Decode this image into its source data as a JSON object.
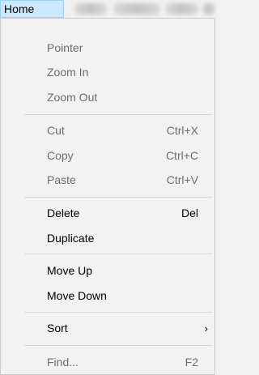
{
  "menubar": {
    "active_tab": "Home",
    "other_tabs_blurred": [
      "tab-2",
      "tab-3",
      "tab-4",
      "tab-5"
    ]
  },
  "menu": {
    "pointer": "Pointer",
    "zoom_in": "Zoom In",
    "zoom_out": "Zoom Out",
    "cut": {
      "label": "Cut",
      "shortcut": "Ctrl+X"
    },
    "copy": {
      "label": "Copy",
      "shortcut": "Ctrl+C"
    },
    "paste": {
      "label": "Paste",
      "shortcut": "Ctrl+V"
    },
    "delete": {
      "label": "Delete",
      "shortcut": "Del"
    },
    "duplicate": "Duplicate",
    "move_up": "Move Up",
    "move_down": "Move Down",
    "sort": {
      "label": "Sort",
      "submenu_icon": "chevron-right-icon"
    },
    "find": {
      "label": "Find...",
      "shortcut": "F2"
    }
  },
  "colors": {
    "active_tab_bg": "#cce8ff",
    "active_tab_border": "#99d1ff",
    "menu_bg": "#f2f2f2",
    "disabled_text": "#6d6d6d",
    "separator": "#d7d7d7"
  }
}
